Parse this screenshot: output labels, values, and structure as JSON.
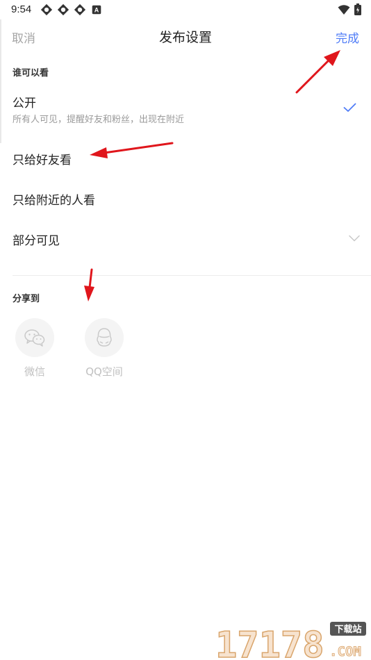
{
  "status_bar": {
    "time": "9:54",
    "badge_letter": "A"
  },
  "nav": {
    "cancel_label": "取消",
    "title": "发布设置",
    "done_label": "完成"
  },
  "visibility": {
    "section_label": "谁可以看",
    "options": [
      {
        "label": "公开",
        "subtitle": "所有人可见，提醒好友和粉丝，出现在附近",
        "selected": true
      },
      {
        "label": "只给好友看"
      },
      {
        "label": "只给附近的人看"
      },
      {
        "label": "部分可见",
        "expandable": true
      }
    ]
  },
  "share": {
    "section_label": "分享到",
    "targets": [
      {
        "label": "微信",
        "icon": "wechat-icon"
      },
      {
        "label": "QQ空间",
        "icon": "qzone-icon"
      }
    ]
  },
  "watermark": {
    "number": "17178",
    "top_text": "下载站",
    "suffix": ".COM"
  },
  "colors": {
    "accent": "#4f7cf7",
    "muted": "#a5a5a5",
    "annotation_arrow": "#e0161c"
  }
}
